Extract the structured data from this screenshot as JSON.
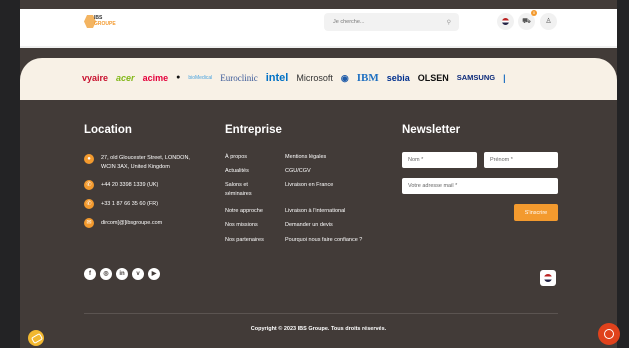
{
  "header": {
    "logo_top": "IBS",
    "logo_bottom": "GROUPE",
    "search_placeholder": "Je cherche...",
    "search_icon": "search-icon",
    "cart_count": "0",
    "user_icon": "user-icon",
    "cart_icon": "cart-icon",
    "flag_icon": "us-flag-icon"
  },
  "brands": [
    "vyaire",
    "acer",
    "acime",
    "",
    "bioMedical",
    "Euroclinic",
    "intel",
    "Microsoft",
    "",
    "IBM",
    "sebia",
    "OLSEN",
    "SAMSUNG",
    "|"
  ],
  "brand_colors": [
    "#c8102e",
    "#83b81a",
    "#e4003b",
    "#111111",
    "#4aa3df",
    "#3b5998",
    "#0071c5",
    "#333333",
    "#1d5aa8",
    "#1f70c1",
    "#00308f",
    "#111111",
    "#0c2a7a",
    "#1f70c1"
  ],
  "location": {
    "title": "Location",
    "address_line1": "27, old Gloucester Street, LONDON,",
    "address_line2": "WCIN 3AX, United Kingdom",
    "phone1": "+44 20 3398 1339 (UK)",
    "phone2": "+33 1 87 66 35 60 (FR)",
    "email": "dircom[@]ibsgroupe.com"
  },
  "entreprise": {
    "title": "Entreprise",
    "col1": [
      "À propos",
      "Actualités",
      "Salons et",
      "séminaires",
      "Notre approche",
      "Nos missions",
      "Nos partenaires"
    ],
    "col2": [
      "Mentions légales",
      "CGU/CGV",
      "Livraison en France",
      "Livraison à l'international",
      "Demander un devis",
      "Pourquoi nous faire confiance ?"
    ]
  },
  "newsletter": {
    "title": "Newsletter",
    "nom_placeholder": "Nom *",
    "prenom_placeholder": "Prénom *",
    "email_placeholder": "Votre adresse mail *",
    "subscribe_label": "S'inscrire"
  },
  "social": {
    "icons": [
      "f",
      "◎",
      "in",
      "v",
      "▶"
    ],
    "names": [
      "facebook-icon",
      "instagram-icon",
      "linkedin-icon",
      "vimeo-icon",
      "youtube-icon"
    ]
  },
  "footer": {
    "copyright": "Copyright © 2023 IBS Groupe. Tous droits réservés."
  },
  "colors": {
    "accent": "#f39a2e",
    "footer_bg": "#423b38",
    "brand_band": "#f8f1e6"
  }
}
